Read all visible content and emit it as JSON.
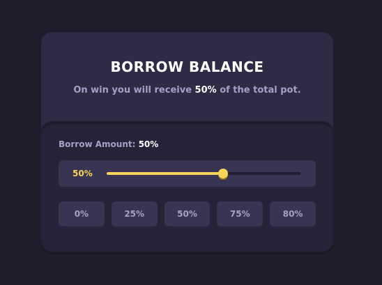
{
  "dialog": {
    "title": "BORROW BALANCE",
    "subtitle_prefix": "On win you will receive ",
    "subtitle_highlight": "50%",
    "subtitle_suffix": " of the total pot."
  },
  "borrow": {
    "label": "Borrow Amount: ",
    "value": "50%",
    "slider_display": "50%",
    "slider_level": 0.6
  },
  "presets": [
    "0%",
    "25%",
    "50%",
    "75%",
    "80%"
  ],
  "colors": {
    "accent": "#f6d55a",
    "background": "#1f1c2b",
    "card": "#2c2840",
    "muted_text": "#a99fc7"
  }
}
